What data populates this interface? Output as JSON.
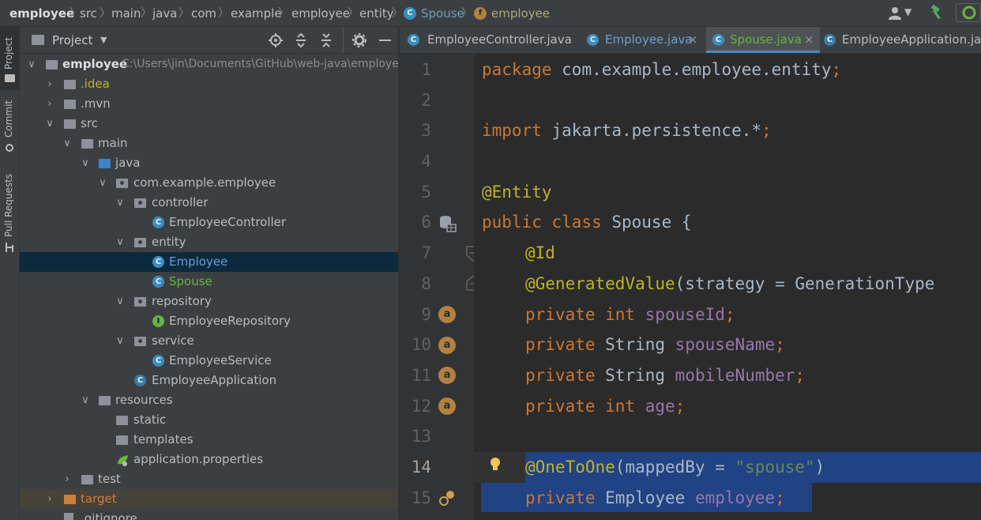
{
  "breadcrumb": {
    "items": [
      "employee",
      "src",
      "main",
      "java",
      "com",
      "example",
      "employee",
      "entity",
      "Spouse",
      "employee"
    ]
  },
  "left_strip": {
    "tabs": [
      "Project",
      "Commit",
      "Pull Requests"
    ]
  },
  "project_panel": {
    "title": "Project",
    "tree": [
      {
        "label": "employee",
        "path": "C:\\Users\\jin\\Documents\\GitHub\\web-java\\employee"
      },
      {
        "label": ".idea"
      },
      {
        "label": ".mvn"
      },
      {
        "label": "src"
      },
      {
        "label": "main"
      },
      {
        "label": "java"
      },
      {
        "label": "com.example.employee"
      },
      {
        "label": "controller"
      },
      {
        "label": "EmployeeController"
      },
      {
        "label": "entity"
      },
      {
        "label": "Employee"
      },
      {
        "label": "Spouse"
      },
      {
        "label": "repository"
      },
      {
        "label": "EmployeeRepository"
      },
      {
        "label": "service"
      },
      {
        "label": "EmployeeService"
      },
      {
        "label": "EmployeeApplication"
      },
      {
        "label": "resources"
      },
      {
        "label": "static"
      },
      {
        "label": "templates"
      },
      {
        "label": "application.properties"
      },
      {
        "label": "test"
      },
      {
        "label": "target"
      },
      {
        "label": ".gitignore"
      }
    ]
  },
  "editor_tabs": [
    {
      "label": "EmployeeController.java",
      "icon": "class-icon"
    },
    {
      "label": "Employee.java",
      "icon": "class-icon"
    },
    {
      "label": "Spouse.java",
      "icon": "class-icon"
    },
    {
      "label": "EmployeeApplication.java",
      "icon": "spring-boot-class-icon"
    }
  ],
  "tab_close_glyph": "×",
  "editor": {
    "line_numbers": [
      "1",
      "2",
      "3",
      "4",
      "5",
      "6",
      "7",
      "8",
      "9",
      "10",
      "11",
      "12",
      "13",
      "14",
      "15"
    ],
    "lines": {
      "l1": {
        "kw": "package",
        "rest": " com.example.employee.entity",
        "semi": ";"
      },
      "l3": {
        "kw": "import",
        "rest": " jakarta.persistence.*",
        "semi": ";"
      },
      "l5": {
        "an": "@Entity"
      },
      "l6": {
        "kw": "public class",
        "rest": " Spouse {"
      },
      "l7": {
        "an": "@Id"
      },
      "l8": {
        "an": "@GeneratedValue",
        "rest": "(strategy = GenerationType"
      },
      "l9": {
        "kw": "private int",
        "fd": "spouseId",
        "semi": ";"
      },
      "l10": {
        "kw": "private",
        "type": " String ",
        "fd": "spouseName",
        "semi": ";"
      },
      "l11": {
        "kw": "private",
        "type": " String ",
        "fd": "mobileNumber",
        "semi": ";"
      },
      "l12": {
        "kw": "private int",
        "fd": "age",
        "semi": ";"
      },
      "l14": {
        "an": "@OneToOne",
        "open": "(mappedBy = ",
        "str": "\"spouse\"",
        "close": ")"
      },
      "l15": {
        "kw": "private",
        "type": " Employee ",
        "fd": "employee",
        "semi": ";"
      }
    }
  },
  "gutter_badge_letter": "a",
  "colors": {
    "keyword": "#cc7832",
    "annotation": "#bbb529",
    "field": "#9876aa",
    "string": "#6a8759",
    "selection": "#214283"
  }
}
